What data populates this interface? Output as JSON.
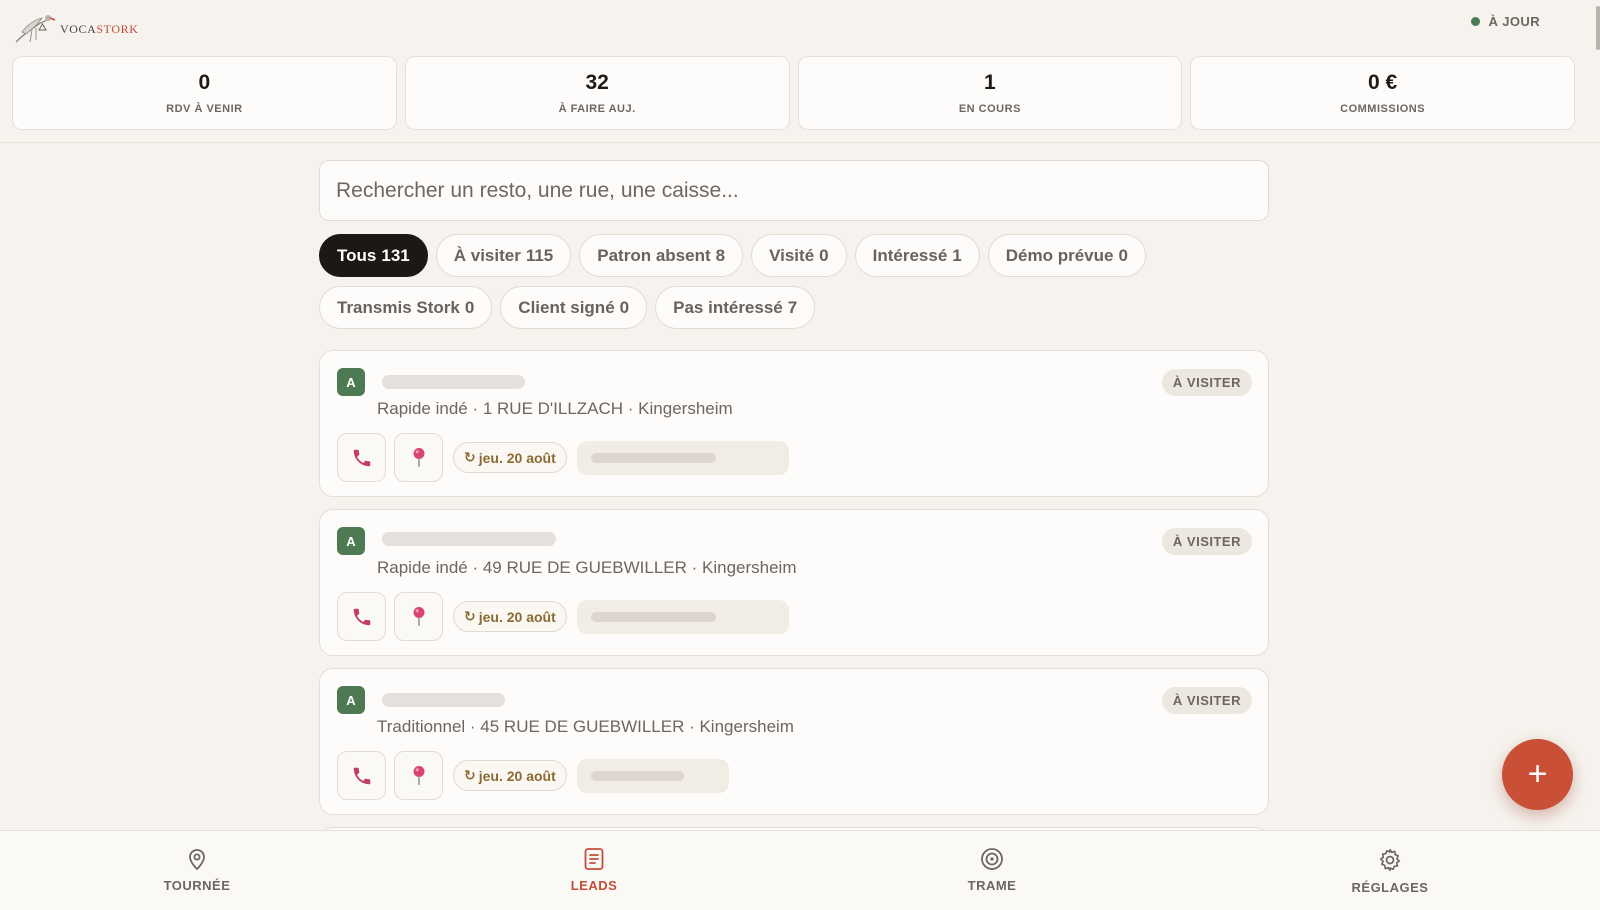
{
  "app": {
    "logo_text_prefix": "VOCA",
    "logo_text_accent": "STORK",
    "sync_status": "À JOUR",
    "colors": {
      "accent": "#c94f37",
      "dark": "#1c1816",
      "grade": "#4d7a52",
      "sync_ok": "#4c7a52"
    }
  },
  "stats": [
    {
      "value": "0",
      "label": "RDV À VENIR"
    },
    {
      "value": "32",
      "label": "À FAIRE AUJ."
    },
    {
      "value": "1",
      "label": "EN COURS"
    },
    {
      "value": "0 €",
      "label": "COMMISSIONS"
    }
  ],
  "search": {
    "placeholder": "Rechercher un resto, une rue, une caisse...",
    "value": ""
  },
  "filters": [
    {
      "label": "Tous",
      "count": "131",
      "active": true
    },
    {
      "label": "À visiter",
      "count": "115"
    },
    {
      "label": "Patron absent",
      "count": "8"
    },
    {
      "label": "Visité",
      "count": "0"
    },
    {
      "label": "Intéressé",
      "count": "1"
    },
    {
      "label": "Démo prévue",
      "count": "0"
    },
    {
      "label": "Transmis Stork",
      "count": "0"
    },
    {
      "label": "Client signé",
      "count": "0"
    },
    {
      "label": "Pas intéressé",
      "count": "7"
    }
  ],
  "leads": [
    {
      "grade": "A",
      "status": "À VISITER",
      "meta": "Rapide indé · 1 RUE D'ILLZACH · Kingersheim",
      "date_icon": "↻",
      "date": "jeu. 20 août",
      "phone_icon": "phone-icon",
      "pin_icon": "map-pin-icon"
    },
    {
      "grade": "A",
      "status": "À VISITER",
      "meta": "Rapide indé · 49 RUE DE GUEBWILLER · Kingersheim",
      "date_icon": "↻",
      "date": "jeu. 20 août",
      "phone_icon": "phone-icon",
      "pin_icon": "map-pin-icon"
    },
    {
      "grade": "A",
      "status": "À VISITER",
      "meta": "Traditionnel · 45 RUE DE GUEBWILLER · Kingersheim",
      "date_icon": "↻",
      "date": "jeu. 20 août",
      "phone_icon": "phone-icon",
      "pin_icon": "map-pin-icon"
    }
  ],
  "fab": {
    "label": "+"
  },
  "nav": [
    {
      "label": "TOURNÉE",
      "icon": "map-pin-outline-icon"
    },
    {
      "label": "LEADS",
      "icon": "document-list-icon",
      "active": true
    },
    {
      "label": "TRAME",
      "icon": "target-icon"
    },
    {
      "label": "RÉGLAGES",
      "icon": "gear-icon"
    }
  ]
}
